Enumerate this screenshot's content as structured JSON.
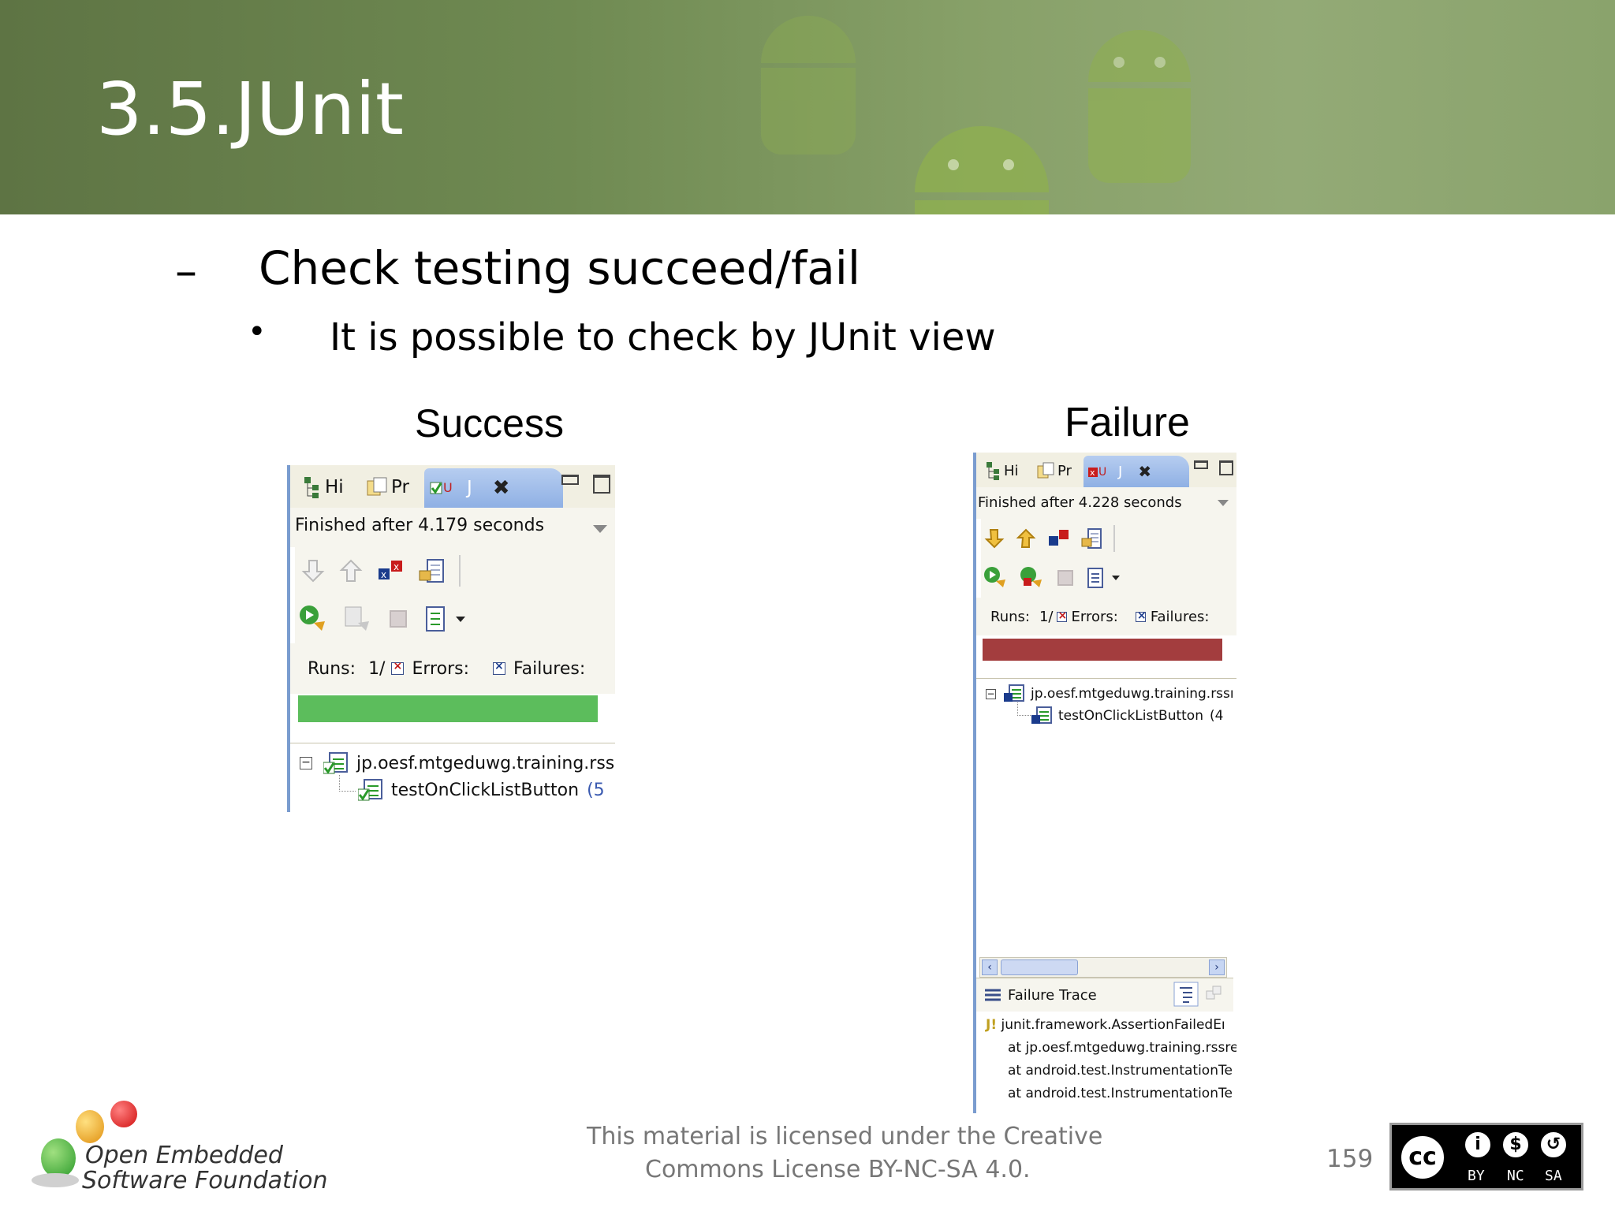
{
  "slide": {
    "title": "3.5.JUnit",
    "level1_marker": "–",
    "level1_text": "Check testing succeed/fail",
    "level2_marker": "•",
    "level2_text": "It is possible to check by JUnit view",
    "success_caption": "Success",
    "failure_caption": "Failure"
  },
  "success_panel": {
    "tabs": [
      "Hi",
      "Pr",
      "J"
    ],
    "status": "Finished after 4.179 seconds",
    "runs_label": "Runs:",
    "runs_value": "1/",
    "errors_label": "Errors:",
    "failures_label": "Failures:",
    "bar_color": "#5cbd5c",
    "bar_state": "success",
    "tree": [
      {
        "label": "jp.oesf.mtgeduwg.training.rssı"
      },
      {
        "label": "testOnClickListButton",
        "suffix": "(5"
      }
    ]
  },
  "failure_panel": {
    "tabs": [
      "Hi",
      "Pr",
      "J"
    ],
    "status": "Finished after 4.228 seconds",
    "runs_label": "Runs:",
    "runs_value": "1/",
    "errors_label": "Errors:",
    "failures_label": "Failures:",
    "bar_color": "#a33d3e",
    "bar_state": "failure",
    "tree": [
      {
        "label": "jp.oesf.mtgeduwg.training.rssı"
      },
      {
        "label": "testOnClickListButton",
        "suffix": "(4"
      }
    ],
    "failure_trace_label": "Failure Trace",
    "trace": [
      "junit.framework.AssertionFailedEı",
      "at jp.oesf.mtgeduwg.training.rssre",
      "at android.test.InstrumentationTe",
      "at android.test.InstrumentationTe"
    ]
  },
  "footer": {
    "logo_line1": "Open Embedded",
    "logo_line2": "Software Foundation",
    "license_line1": "This material is licensed under the Creative",
    "license_line2": "Commons License BY-NC-SA 4.0.",
    "page_number": "159",
    "cc_labels": [
      "BY",
      "NC",
      "SA"
    ],
    "cc_mark": "cc"
  }
}
